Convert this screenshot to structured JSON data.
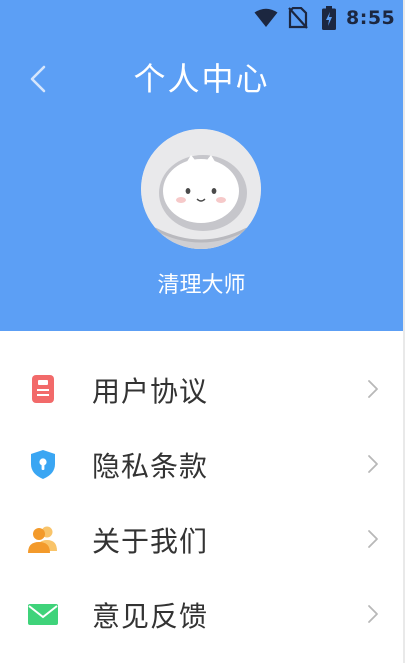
{
  "status_bar": {
    "time": "8:55",
    "icons": [
      "wifi-icon",
      "no-sim-icon",
      "battery-charging-icon"
    ]
  },
  "header": {
    "title": "个人中心",
    "back_icon": "chevron-left-icon",
    "user": {
      "name": "清理大师",
      "avatar_icon": "astronaut-cat-avatar"
    }
  },
  "menu": {
    "items": [
      {
        "label": "用户协议",
        "icon": "document-icon",
        "color": "#f26a6a"
      },
      {
        "label": "隐私条款",
        "icon": "shield-lock-icon",
        "color": "#3aa6f3"
      },
      {
        "label": "关于我们",
        "icon": "users-icon",
        "color": "#f7a93a"
      },
      {
        "label": "意见反馈",
        "icon": "mail-icon",
        "color": "#3fd37a"
      }
    ]
  },
  "colors": {
    "header_bg": "#5c9ff5",
    "status_icon": "#1c2740",
    "text": "#333333",
    "chevron": "#b8b8b8"
  }
}
